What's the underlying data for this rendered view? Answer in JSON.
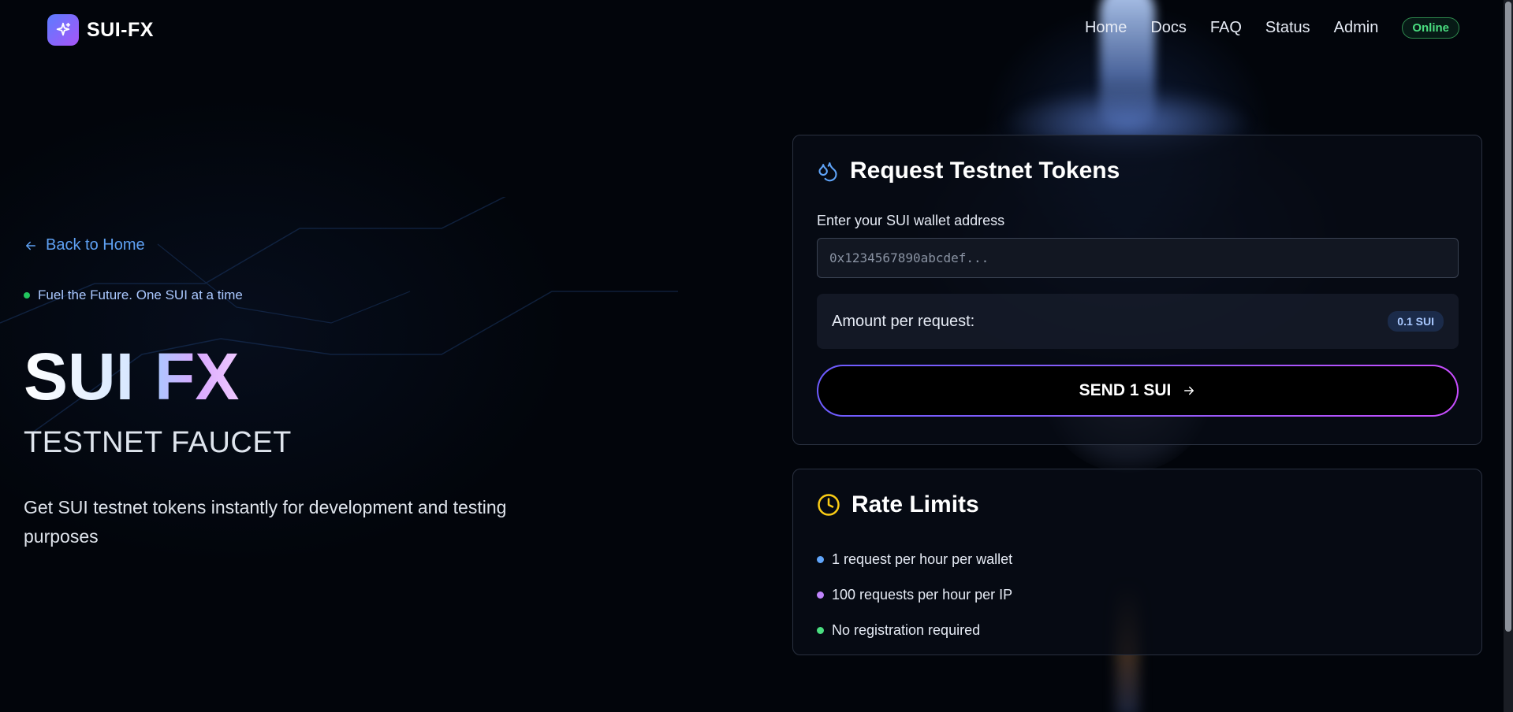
{
  "app": {
    "name": "SUI-FX"
  },
  "nav": {
    "items": [
      "Home",
      "Docs",
      "FAQ",
      "Status",
      "Admin"
    ],
    "status_badge": "Online"
  },
  "hero": {
    "back_link": "Back to Home",
    "tagline": "Fuel the Future. One SUI at a time",
    "title_part1": "SUI",
    "title_part2": "FX",
    "subtitle": "TESTNET FAUCET",
    "description": "Get SUI testnet tokens instantly for development and testing purposes"
  },
  "request_card": {
    "title": "Request Testnet Tokens",
    "wallet_label": "Enter your SUI wallet address",
    "wallet_placeholder": "0x1234567890abcdef...",
    "wallet_value": "",
    "amount_label": "Amount per request:",
    "amount_value": "0.1 SUI",
    "send_label": "SEND 1 SUI"
  },
  "rate_card": {
    "title": "Rate Limits",
    "rules": [
      {
        "text": "1 request per hour per wallet",
        "color": "#60a5fa"
      },
      {
        "text": "100 requests per hour per IP",
        "color": "#c084fc"
      },
      {
        "text": "No registration required",
        "color": "#4ade80"
      }
    ]
  },
  "colors": {
    "accent_blue": "#5ea0f2",
    "accent_purple": "#a855f7",
    "status_green": "#4ade80",
    "clock_yellow": "#facc15"
  },
  "icons": [
    "sparkle-icon",
    "arrow-left-icon",
    "droplets-icon",
    "arrow-right-icon",
    "clock-icon"
  ]
}
